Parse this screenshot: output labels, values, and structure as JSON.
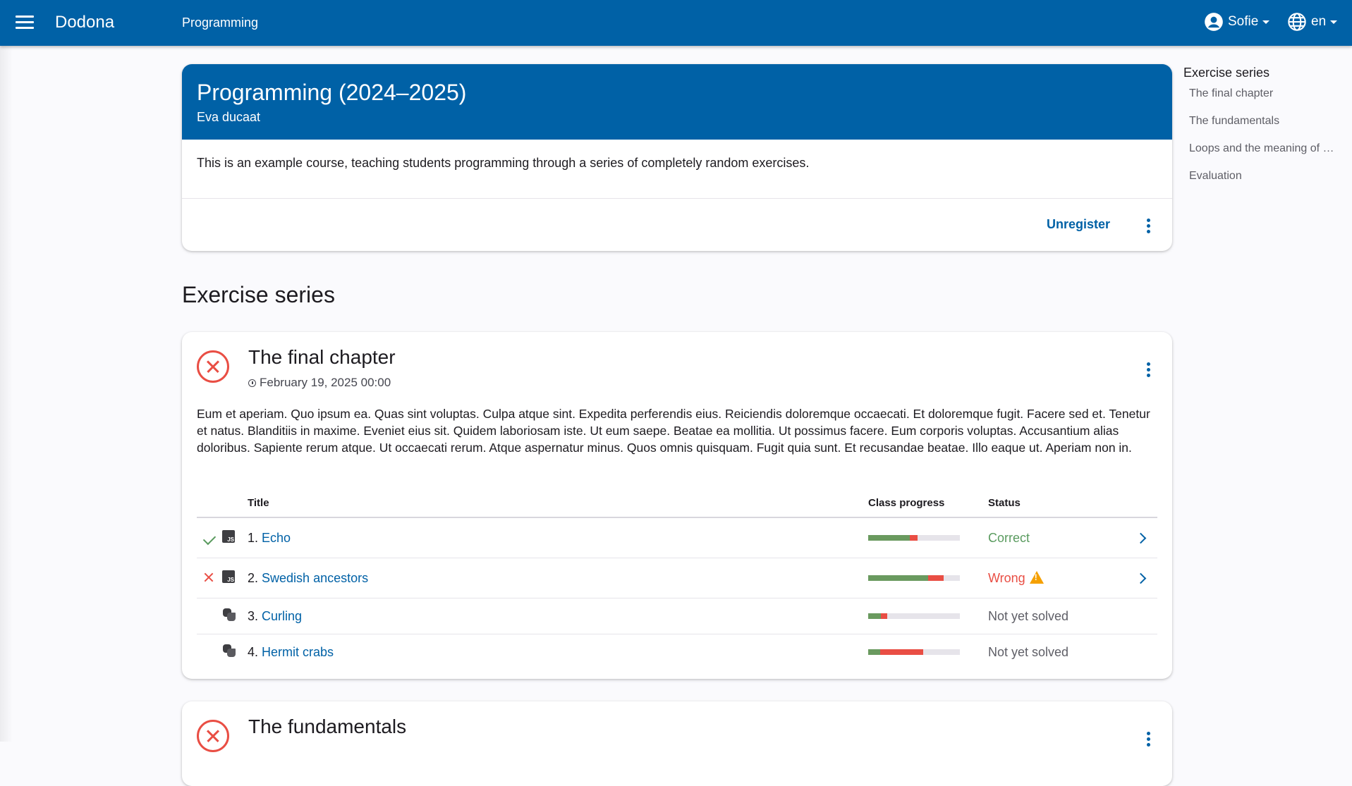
{
  "appbar": {
    "brand": "Dodona",
    "breadcrumb": "Programming",
    "user_name": "Sofie",
    "language": "en"
  },
  "course": {
    "title": "Programming (2024–2025)",
    "teacher": "Eva ducaat",
    "description": "This is an example course, teaching students programming through a series of completely random exercises.",
    "unregister_label": "Unregister"
  },
  "section_title": "Exercise series",
  "series": [
    {
      "title": "The final chapter",
      "deadline": "February 19, 2025 00:00",
      "description": "Eum et aperiam. Quo ipsum ea. Quas sint voluptas. Culpa atque sint. Expedita perferendis eius. Reiciendis doloremque occaecati. Et doloremque fugit. Facere sed et. Tenetur et natus. Blanditiis in maxime. Eveniet eius sit. Quidem laboriosam iste. Ut eum saepe. Beatae ea mollitia. Ut possimus facere. Eum corporis voluptas. Accusantium alias doloribus. Sapiente rerum atque. Ut occaecati rerum. Atque aspernatur minus. Quos omnis quisquam. Fugit quia sunt. Et recusandae beatae. Illo eaque ut. Aperiam non in.",
      "columns": {
        "title": "Title",
        "progress": "Class progress",
        "status": "Status"
      },
      "exercises": [
        {
          "number": "1.",
          "name": "Echo",
          "type_icon": "javascript-icon",
          "result_icon": "check-icon",
          "progress_correct": 0.45,
          "progress_wrong": 0.09,
          "status": "Correct",
          "status_kind": "correct",
          "warning": false,
          "has_chevron": true
        },
        {
          "number": "2.",
          "name": "Swedish ancestors",
          "type_icon": "javascript-icon",
          "result_icon": "x-icon",
          "progress_correct": 0.65,
          "progress_wrong": 0.17,
          "status": "Wrong",
          "status_kind": "wrong",
          "warning": true,
          "has_chevron": true
        },
        {
          "number": "3.",
          "name": "Curling",
          "type_icon": "python-icon",
          "result_icon": "",
          "progress_correct": 0.14,
          "progress_wrong": 0.07,
          "status": "Not yet solved",
          "status_kind": "none",
          "warning": false,
          "has_chevron": false
        },
        {
          "number": "4.",
          "name": "Hermit crabs",
          "type_icon": "python-icon",
          "result_icon": "",
          "progress_correct": 0.13,
          "progress_wrong": 0.47,
          "status": "Not yet solved",
          "status_kind": "none",
          "warning": false,
          "has_chevron": false
        }
      ]
    },
    {
      "title": "The fundamentals"
    }
  ],
  "toc": {
    "title": "Exercise series",
    "items": [
      "The final chapter",
      "The fundamentals",
      "Loops and the meaning of …",
      "Evaluation"
    ]
  },
  "colors": {
    "primary": "#0061a6",
    "correct": "#5a9b5f",
    "wrong": "#e94e44",
    "warning": "#f5a000"
  }
}
